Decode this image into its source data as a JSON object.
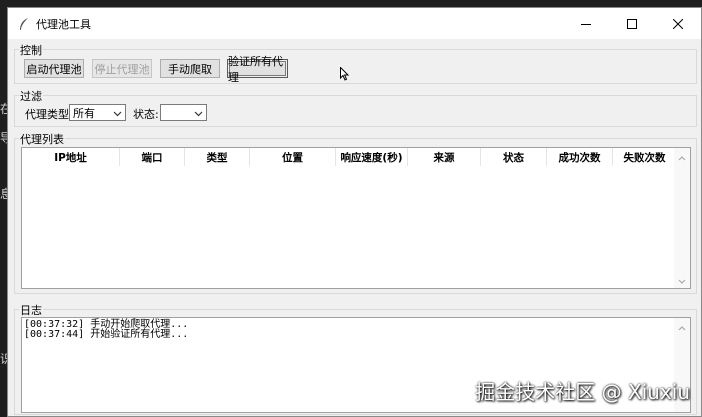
{
  "background": {
    "edge_chars": [
      "在",
      "导",
      "息",
      "识"
    ]
  },
  "window": {
    "title": "代理池工具"
  },
  "control": {
    "label": "控制",
    "buttons": [
      {
        "label": "启动代理池",
        "state": "normal"
      },
      {
        "label": "停止代理池",
        "state": "disabled"
      },
      {
        "label": "手动爬取",
        "state": "normal"
      },
      {
        "label": "验证所有代理",
        "state": "focused"
      }
    ]
  },
  "filter": {
    "label": "过滤",
    "type_label": "代理类型:",
    "type_value": "所有",
    "status_label": "状态:",
    "status_value": ""
  },
  "proxy_list": {
    "label": "代理列表",
    "columns": [
      "IP地址",
      "端口",
      "类型",
      "位置",
      "响应速度(秒)",
      "来源",
      "状态",
      "成功次数",
      "失败次数"
    ],
    "rows": []
  },
  "log": {
    "label": "日志",
    "lines": [
      "[00:37:32] 手动开始爬取代理...",
      "[00:37:44] 开始验证所有代理..."
    ]
  },
  "watermark": "掘金技术社区 @ Xiuxiu"
}
